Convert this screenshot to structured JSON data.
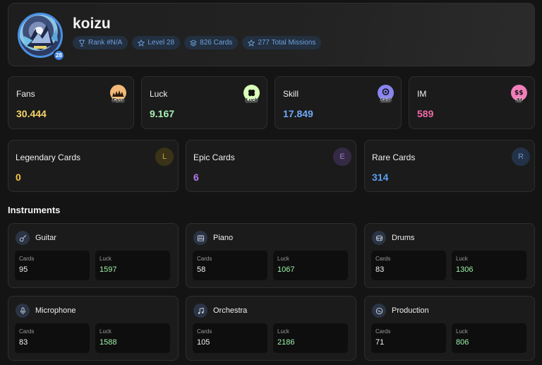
{
  "profile": {
    "username": "koizu",
    "level_badge": "28",
    "chips": [
      {
        "icon": "trophy-icon",
        "label": "Rank #N/A"
      },
      {
        "icon": "star-icon",
        "label": "Level 28"
      },
      {
        "icon": "layers-icon",
        "label": "826 Cards"
      },
      {
        "icon": "star-icon",
        "label": "277 Total Missions"
      }
    ]
  },
  "stats": [
    {
      "label": "Fans",
      "value": "30.444",
      "color": "#f5d36a",
      "icon": "fans-icon",
      "icon_color": "#f2b979",
      "icon_caption": "Fans"
    },
    {
      "label": "Luck",
      "value": "9.167",
      "color": "#a6f0b3",
      "icon": "clover-icon",
      "icon_color": "#d9ffb8",
      "icon_caption": "Luck"
    },
    {
      "label": "Skill",
      "value": "17.849",
      "color": "#6fa8f5",
      "icon": "skill-icon",
      "icon_color": "#8a84f0",
      "icon_caption": "Skill"
    },
    {
      "label": "IM",
      "value": "589",
      "color": "#f06aa6",
      "icon": "im-icon",
      "icon_color": "#f07eb8",
      "icon_caption": "IM"
    }
  ],
  "rarities": [
    {
      "label": "Legendary Cards",
      "value": "0",
      "letter": "L",
      "color": "#f5c542",
      "icon_bg": "#3a3318",
      "icon_fg": "#c9a23a"
    },
    {
      "label": "Epic Cards",
      "value": "6",
      "letter": "E",
      "color": "#b57cf5",
      "icon_bg": "#352a44",
      "icon_fg": "#9d7cc9"
    },
    {
      "label": "Rare Cards",
      "value": "314",
      "letter": "R",
      "color": "#5aa0f2",
      "icon_bg": "#243247",
      "icon_fg": "#6a92c9"
    }
  ],
  "instruments_title": "Instruments",
  "instruments": [
    {
      "name": "Guitar",
      "icon": "guitar-icon",
      "cards_label": "Cards",
      "cards": "95",
      "luck_label": "Luck",
      "luck": "1597"
    },
    {
      "name": "Piano",
      "icon": "piano-icon",
      "cards_label": "Cards",
      "cards": "58",
      "luck_label": "Luck",
      "luck": "1067"
    },
    {
      "name": "Drums",
      "icon": "drum-icon",
      "cards_label": "Cards",
      "cards": "83",
      "luck_label": "Luck",
      "luck": "1306"
    },
    {
      "name": "Microphone",
      "icon": "microphone-icon",
      "cards_label": "Cards",
      "cards": "83",
      "luck_label": "Luck",
      "luck": "1588"
    },
    {
      "name": "Orchestra",
      "icon": "music-note-icon",
      "cards_label": "Cards",
      "cards": "105",
      "luck_label": "Luck",
      "luck": "2186"
    },
    {
      "name": "Production",
      "icon": "disc-icon",
      "cards_label": "Cards",
      "cards": "71",
      "luck_label": "Luck",
      "luck": "806"
    }
  ],
  "colors": {
    "luck_value": "#9ef0a8",
    "accent": "#4a90e2"
  }
}
